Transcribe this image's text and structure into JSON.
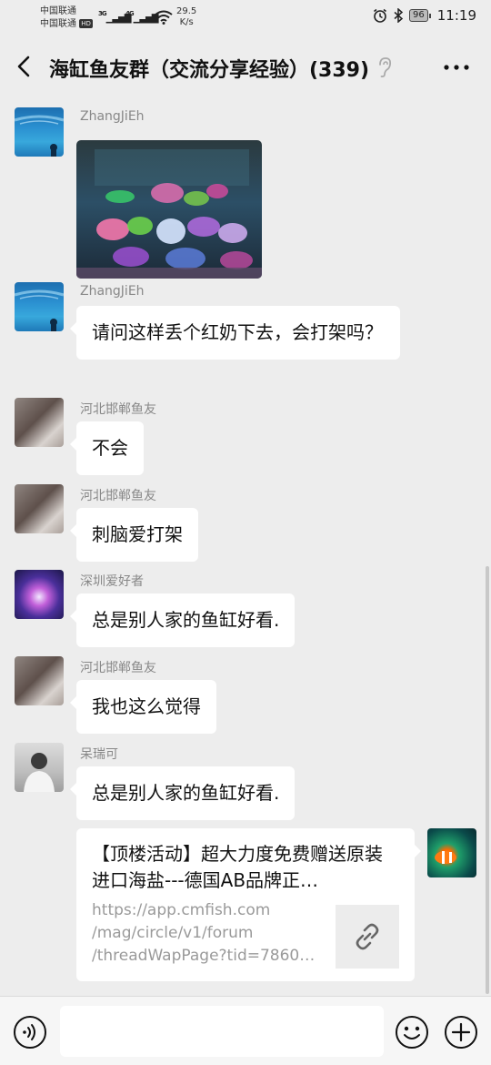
{
  "status": {
    "carrier1": "中国联通",
    "carrier2": "中国联通",
    "hd": "HD",
    "signal1": "3G",
    "signal2": "4G",
    "speed_value": "29.5",
    "speed_unit": "K/s",
    "battery": "96",
    "time": "11:19"
  },
  "header": {
    "title": "海缸鱼友群（交流分享经验）(339)",
    "icons": {
      "back": "back-arrow-icon",
      "ear": "ear-icon",
      "more": "more-icon"
    }
  },
  "messages": [
    {
      "sender": "ZhangJiEh",
      "type": "image"
    },
    {
      "sender": "ZhangJiEh",
      "text": "请问这样丢个红奶下去，会打架吗？"
    },
    {
      "sender": "河北邯郸鱼友",
      "text": "不会"
    },
    {
      "sender": "河北邯郸鱼友",
      "text": "刺脑爱打架"
    },
    {
      "sender": "深圳爱好者",
      "text": "总是别人家的鱼缸好看."
    },
    {
      "sender": "河北邯郸鱼友",
      "text": "我也这么觉得"
    },
    {
      "sender": "呆瑞可",
      "text": "总是别人家的鱼缸好看."
    }
  ],
  "link_message": {
    "title": "【顶楼活动】超大力度免费赠送原装进口海盐---德国AB品牌正…",
    "url_lines": [
      "https://app.cmfish.com",
      "/mag/circle/v1/forum",
      "/threadWapPage?tid=78601…"
    ],
    "thumb_icon": "link-icon"
  },
  "input_bar": {
    "placeholder": "",
    "icons": {
      "voice": "voice-icon",
      "emoji": "emoji-icon",
      "plus": "plus-icon"
    }
  },
  "colors": {
    "background": "#ededed",
    "bubble": "#ffffff",
    "sender_name": "#888888",
    "link_url": "#9a9a9a"
  }
}
